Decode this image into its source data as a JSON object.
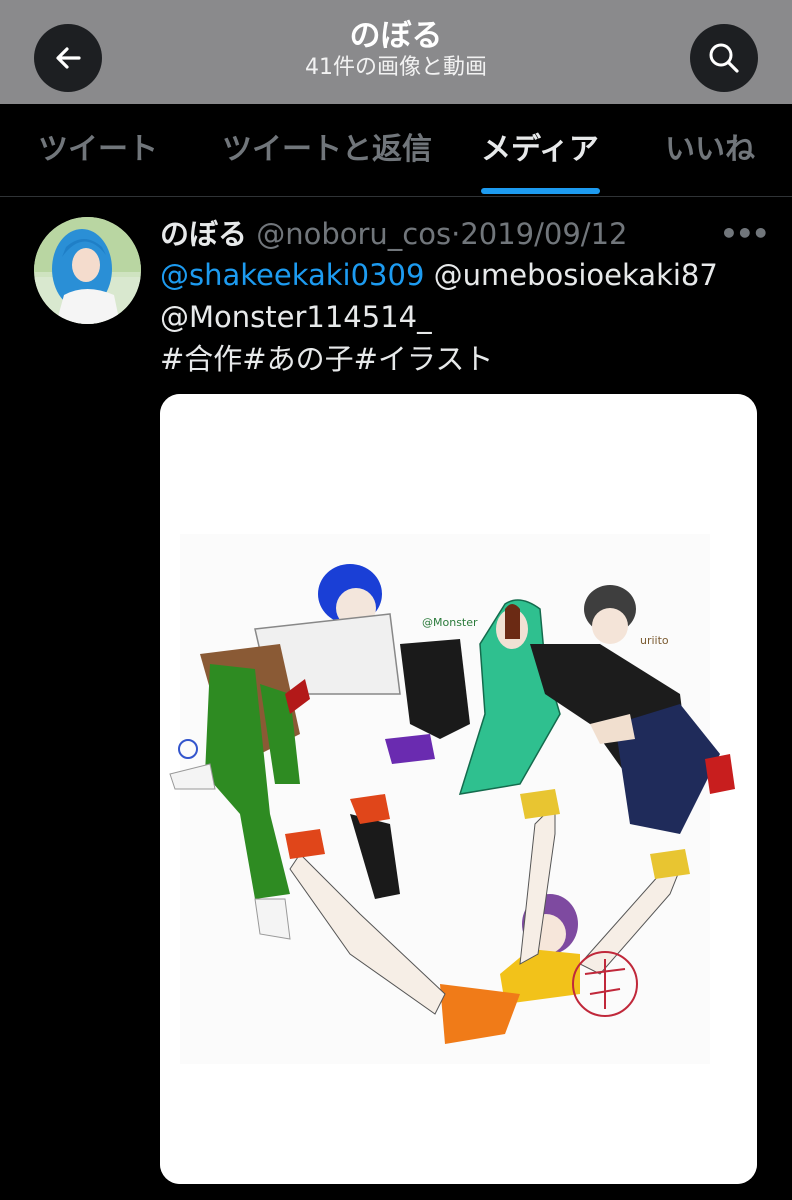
{
  "header": {
    "title": "のぼる",
    "subtitle": "41件の画像と動画",
    "back_icon": "arrow-left-icon",
    "search_icon": "search-icon"
  },
  "tabs": [
    {
      "label": "ツイート",
      "active": false
    },
    {
      "label": "ツイートと返信",
      "active": false
    },
    {
      "label": "メディア",
      "active": true
    },
    {
      "label": "いいね",
      "active": false
    }
  ],
  "tweet": {
    "name": "のぼる",
    "handle": "@noboru_cos",
    "separator": "·",
    "date": "2019/09/12",
    "more_icon": "more-icon",
    "mentions": [
      "@shakeekaki0309",
      "@umebosioekaki87",
      "@Monster114514_"
    ],
    "hashtags": "#合作#あの子#イラスト",
    "image": {
      "signature_left": "@Monster",
      "signature_right": "uriito"
    }
  },
  "colors": {
    "accent": "#1d9bf0",
    "header_bg": "#8a8a8c",
    "background": "#000000",
    "muted_text": "#71767b"
  }
}
